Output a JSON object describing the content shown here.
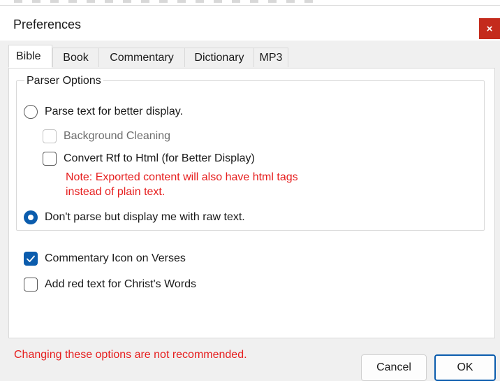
{
  "window": {
    "title": "Preferences",
    "close_symbol": "×"
  },
  "tabs": [
    {
      "label": "Bible",
      "active": true
    },
    {
      "label": "Book",
      "active": false
    },
    {
      "label": "Commentary",
      "active": false
    },
    {
      "label": "Dictionary",
      "active": false
    },
    {
      "label": "MP3",
      "active": false
    }
  ],
  "parser_options": {
    "legend": "Parser Options",
    "parse_radio": {
      "label": "Parse text for better display.",
      "checked": false
    },
    "background_cleaning": {
      "label": "Background Cleaning",
      "checked": false,
      "enabled": false
    },
    "convert_rtf": {
      "label": "Convert Rtf to Html (for Better Display)",
      "checked": false
    },
    "note_line1": "Note: Exported content will also have html tags",
    "note_line2": "instead of plain text.",
    "raw_radio": {
      "label": "Don't parse but display me  with raw text.",
      "checked": true
    }
  },
  "options": {
    "commentary_icon": {
      "label": "Commentary Icon on Verses",
      "checked": true
    },
    "red_text": {
      "label": "Add red text for Christ's Words",
      "checked": false
    }
  },
  "footer": {
    "warning": "Changing these options are not recommended.",
    "cancel_label": "Cancel",
    "ok_label": "OK"
  },
  "colors": {
    "accent": "#0b5cad",
    "warning_text": "#e61e1e",
    "close_button": "#c42b1c"
  },
  "icons": {
    "close": "close-icon",
    "check": "checkmark-icon"
  }
}
